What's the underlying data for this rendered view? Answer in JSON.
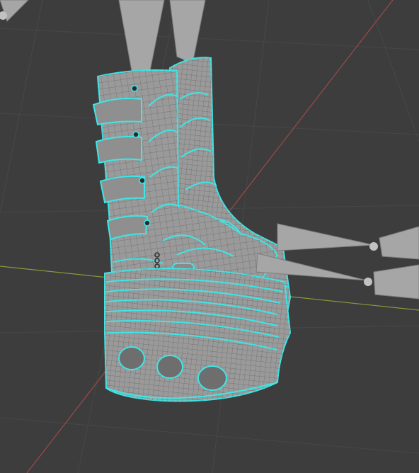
{
  "viewport": {
    "background": "#3d3d3d",
    "grid_color": "#474747",
    "x_axis_color": "#8a9a3c",
    "y_axis_color": "#9c4a4a",
    "wire_color": "#3ee6e6",
    "mesh_fill": "#9a9a9a",
    "mesh_shadow": "#7a7a7a",
    "mesh_line": "#6a6a6a",
    "bone_color": "#a6a6a6",
    "bone_dark": "#8a8a8a"
  }
}
